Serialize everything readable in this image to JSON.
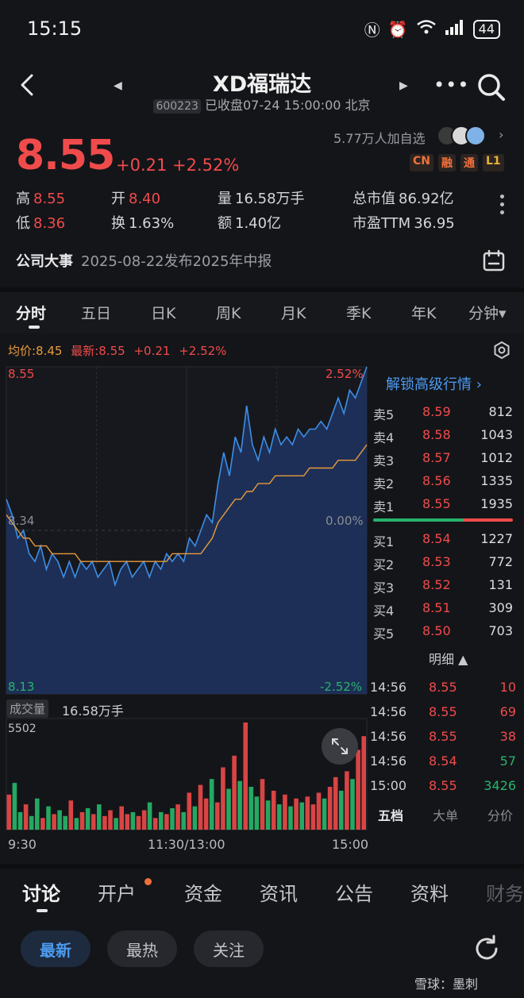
{
  "status_bar": {
    "time": "15:15",
    "battery": "44",
    "signal_label": "6"
  },
  "header": {
    "title": "XD福瑞达",
    "code": "600223",
    "status": "已收盘07-24 15:00:00 北京",
    "prev_icon": "left-triangle-icon",
    "next_icon": "right-triangle-icon"
  },
  "quote": {
    "price": "8.55",
    "change": "+0.21",
    "change_pct": "+2.52%",
    "watch_count": "5.77万人加自选",
    "tags": [
      "CN",
      "融",
      "通",
      "L1"
    ]
  },
  "stats": {
    "high_label": "高",
    "high": "8.55",
    "low_label": "低",
    "low": "8.36",
    "open_label": "开",
    "open": "8.40",
    "turnover_label": "换",
    "turnover": "1.63%",
    "volume_label": "量",
    "volume": "16.58万手",
    "amount_label": "额",
    "amount": "1.40亿",
    "mcap_label": "总市值",
    "mcap": "86.92亿",
    "pe_label": "市盈TTM",
    "pe": "36.95"
  },
  "event": {
    "title": "公司大事",
    "text": "2025-08-22发布2025年中报"
  },
  "period_tabs": [
    "分时",
    "五日",
    "日K",
    "周K",
    "月K",
    "季K",
    "年K",
    "分钟▾"
  ],
  "intraday": {
    "avg_label": "均价:8.45",
    "latest_label": "最新:8.55",
    "latest_change": "+0.21",
    "latest_pct": "+2.52%",
    "y_top": "8.55",
    "y_mid": "8.34",
    "y_bottom": "8.13",
    "pct_top": "2.52%",
    "pct_mid": "0.00%",
    "pct_bottom": "-2.52%",
    "x_labels": [
      "9:30",
      "11:30/13:00",
      "15:00"
    ],
    "volume_label": "成交量",
    "volume_total": "16.58万手",
    "volume_max": "5502"
  },
  "chart_data": {
    "type": "line",
    "y_range": [
      8.13,
      8.55
    ],
    "prev_close": 8.34,
    "price": [
      8.38,
      8.36,
      8.33,
      8.34,
      8.31,
      8.3,
      8.32,
      8.29,
      8.31,
      8.3,
      8.28,
      8.3,
      8.28,
      8.3,
      8.29,
      8.3,
      8.28,
      8.29,
      8.3,
      8.27,
      8.29,
      8.3,
      8.28,
      8.29,
      8.3,
      8.28,
      8.3,
      8.29,
      8.31,
      8.3,
      8.31,
      8.3,
      8.33,
      8.32,
      8.34,
      8.36,
      8.35,
      8.4,
      8.44,
      8.41,
      8.46,
      8.44,
      8.5,
      8.45,
      8.43,
      8.46,
      8.44,
      8.47,
      8.45,
      8.46,
      8.45,
      8.47,
      8.46,
      8.47,
      8.47,
      8.48,
      8.47,
      8.49,
      8.51,
      8.49,
      8.52,
      8.51,
      8.53,
      8.55
    ],
    "avg": [
      8.36,
      8.35,
      8.34,
      8.33,
      8.33,
      8.32,
      8.32,
      8.32,
      8.31,
      8.31,
      8.31,
      8.31,
      8.31,
      8.3,
      8.3,
      8.3,
      8.3,
      8.3,
      8.3,
      8.3,
      8.3,
      8.3,
      8.3,
      8.3,
      8.3,
      8.3,
      8.3,
      8.3,
      8.3,
      8.31,
      8.31,
      8.31,
      8.31,
      8.31,
      8.31,
      8.32,
      8.33,
      8.35,
      8.36,
      8.37,
      8.38,
      8.38,
      8.39,
      8.39,
      8.4,
      8.4,
      8.4,
      8.41,
      8.41,
      8.41,
      8.41,
      8.41,
      8.41,
      8.42,
      8.42,
      8.42,
      8.42,
      8.42,
      8.43,
      8.43,
      8.43,
      8.43,
      8.44,
      8.45
    ],
    "volume": [
      1800,
      2400,
      900,
      1300,
      700,
      1600,
      600,
      1200,
      800,
      1000,
      700,
      1500,
      600,
      900,
      1100,
      800,
      1300,
      700,
      1000,
      600,
      1200,
      800,
      900,
      700,
      1000,
      1400,
      600,
      900,
      800,
      1100,
      1300,
      900,
      1900,
      1200,
      2300,
      1600,
      2600,
      1400,
      3200,
      2100,
      3800,
      2500,
      5502,
      2200,
      1700,
      2600,
      1500,
      2000,
      1300,
      1800,
      1200,
      1600,
      1400,
      1700,
      1300,
      1900,
      1600,
      2200,
      2700,
      2000,
      3000,
      2600,
      4100,
      4800
    ],
    "sessions": [
      "9:30",
      "11:30/13:00",
      "15:00"
    ]
  },
  "order_book": {
    "unlock_label": "解锁高级行情",
    "asks": [
      {
        "label": "卖5",
        "price": "8.59",
        "vol": "812"
      },
      {
        "label": "卖4",
        "price": "8.58",
        "vol": "1043"
      },
      {
        "label": "卖3",
        "price": "8.57",
        "vol": "1012"
      },
      {
        "label": "卖2",
        "price": "8.56",
        "vol": "1335"
      },
      {
        "label": "卖1",
        "price": "8.55",
        "vol": "1935"
      }
    ],
    "bids": [
      {
        "label": "买1",
        "price": "8.54",
        "vol": "1227"
      },
      {
        "label": "买2",
        "price": "8.53",
        "vol": "772"
      },
      {
        "label": "买3",
        "price": "8.52",
        "vol": "131"
      },
      {
        "label": "买4",
        "price": "8.51",
        "vol": "309"
      },
      {
        "label": "买5",
        "price": "8.50",
        "vol": "703"
      }
    ],
    "detail_label": "明细 ▲",
    "trades": [
      {
        "time": "14:56",
        "price": "8.55",
        "vol": "10"
      },
      {
        "time": "14:56",
        "price": "8.55",
        "vol": "69"
      },
      {
        "time": "14:56",
        "price": "8.55",
        "vol": "38"
      },
      {
        "time": "14:56",
        "price": "8.54",
        "vol": "57"
      },
      {
        "time": "15:00",
        "price": "8.55",
        "vol": "3426"
      }
    ],
    "tabs": [
      "五档",
      "大单",
      "分价"
    ]
  },
  "bottom_tabs": [
    "讨论",
    "开户",
    "资金",
    "资讯",
    "公告",
    "资料",
    "财务"
  ],
  "filter_pills": [
    "最新",
    "最热",
    "关注"
  ],
  "watermark": "雪球：墨刺",
  "colors": {
    "up": "#f04b4b",
    "down": "#27b36b",
    "price_line": "#3d8ee8",
    "avg_line": "#e89a3c",
    "accent": "#4c9bef"
  }
}
